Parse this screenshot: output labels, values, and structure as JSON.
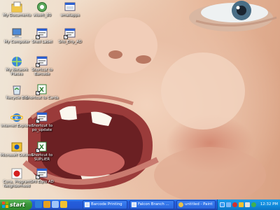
{
  "desktop": {
    "icons": [
      {
        "label": "My Documents",
        "icon": "my-documents-icon"
      },
      {
        "label": "vlisoft_80",
        "icon": "program-icon"
      },
      {
        "label": "smallapps",
        "icon": "folder-window-icon"
      },
      {
        "label": "My Computer",
        "icon": "my-computer-icon"
      },
      {
        "label": "Shell Label",
        "icon": "shortcut-icon"
      },
      {
        "label": "Shil_Erly_AD",
        "icon": "shortcut-icon"
      },
      {
        "label": "My Network Places",
        "icon": "network-places-icon"
      },
      {
        "label": "Shortcut to Barcode",
        "icon": "shortcut-icon"
      },
      {
        "label": "Recycle Bin",
        "icon": "recycle-bin-icon"
      },
      {
        "label": "Shortcut to Cards",
        "icon": "excel-shortcut-icon"
      },
      {
        "label": "Internet Explorer",
        "icon": "internet-explorer-icon"
      },
      {
        "label": "Shortcut to po_update",
        "icon": "shortcut-icon"
      },
      {
        "label": "Microsoft Outlook",
        "icon": "outlook-icon"
      },
      {
        "label": "Shortcut to SUPLIER",
        "icon": "excel-shortcut-icon"
      },
      {
        "label": "Cons. Program Neighborhood",
        "icon": "citrix-icon"
      },
      {
        "label": "SHI Eqns AD",
        "icon": "shortcut-icon"
      }
    ]
  },
  "taskbar": {
    "start_label": "start",
    "quick_launch": [
      "browser-icon",
      "media-icon",
      "desktop-icon",
      "outlook-icon"
    ],
    "tasks": [
      {
        "label": "Barcode Printing",
        "icon": "window-icon"
      },
      {
        "label": "Falcon Branch ...",
        "icon": "window-icon"
      },
      {
        "label": "untitled - Paint",
        "icon": "paint-icon"
      }
    ],
    "clock": "12:32 PM"
  },
  "colors": {
    "taskbar_blue": "#245edc",
    "start_green": "#3c9a3c",
    "tray_blue": "#108adb"
  }
}
